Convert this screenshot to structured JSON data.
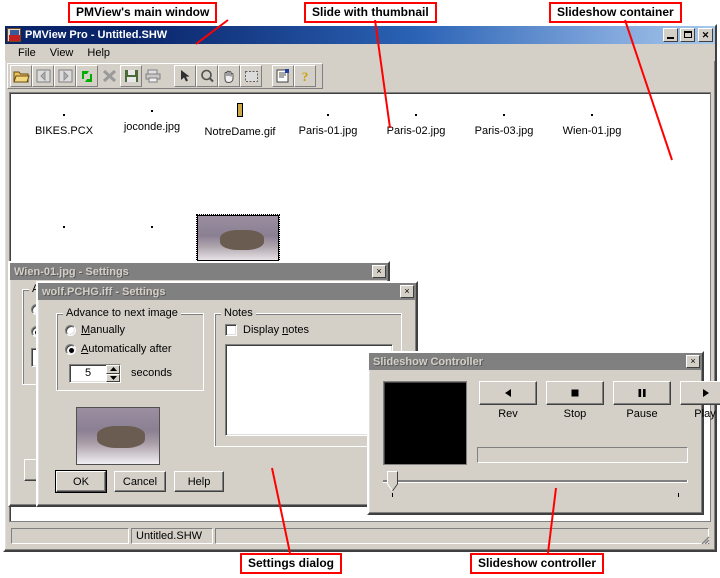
{
  "annotations": [
    {
      "id": "ann-main-window",
      "text": "PMView's main window"
    },
    {
      "id": "ann-slide-thumbnail",
      "text": "Slide with thumbnail"
    },
    {
      "id": "ann-slideshow-container",
      "text": "Slideshow container"
    },
    {
      "id": "ann-settings-dialog",
      "text": "Settings dialog"
    },
    {
      "id": "ann-slideshow-controller",
      "text": "Slideshow controller"
    }
  ],
  "main_window": {
    "title": "PMView Pro - Untitled.SHW",
    "icon": "pmview-app-icon",
    "window_buttons": {
      "minimize": "minimize-button",
      "maximize": "maximize-button",
      "close": "close-button"
    },
    "menu": [
      {
        "label": "File"
      },
      {
        "label": "View"
      },
      {
        "label": "Help"
      }
    ],
    "toolbar": [
      {
        "name": "open-folder-icon",
        "glyph": "open"
      },
      {
        "name": "previous-icon",
        "glyph": "left"
      },
      {
        "name": "next-icon",
        "glyph": "right"
      },
      {
        "name": "refresh-icon",
        "glyph": "refresh"
      },
      {
        "name": "delete-icon",
        "glyph": "x"
      },
      {
        "name": "save-icon",
        "glyph": "save"
      },
      {
        "name": "print-icon",
        "glyph": "print"
      },
      {
        "name": "pointer-icon",
        "glyph": "arrow"
      },
      {
        "name": "zoom-icon",
        "glyph": "magnifier"
      },
      {
        "name": "pan-hand-icon",
        "glyph": "hand"
      },
      {
        "name": "select-region-icon",
        "glyph": "marquee"
      },
      {
        "name": "properties-icon",
        "glyph": "properties"
      },
      {
        "name": "help-icon",
        "glyph": "question"
      }
    ],
    "slides": [
      {
        "caption": "BIKES.PCX",
        "art": "img-bikes",
        "selected": false
      },
      {
        "caption": "joconde.jpg",
        "art": "img-joconde",
        "selected": false
      },
      {
        "caption": "NotreDame.gif",
        "art": "img-notre",
        "selected": false
      },
      {
        "caption": "Paris-01.jpg",
        "art": "img-paris01",
        "selected": false
      },
      {
        "caption": "Paris-02.jpg",
        "art": "img-paris02",
        "selected": false
      },
      {
        "caption": "Paris-03.jpg",
        "art": "img-paris03",
        "selected": false
      },
      {
        "caption": "Wien-01.jpg",
        "art": "img-wien",
        "selected": false
      },
      {
        "caption": "",
        "art": "img-office",
        "selected": false
      },
      {
        "caption": "",
        "art": "img-danube",
        "selected": false
      },
      {
        "caption": "",
        "art": "img-wolf",
        "selected": true
      }
    ],
    "statusbar": {
      "left_panel": "",
      "file_panel": "Untitled.SHW",
      "right_panel": ""
    }
  },
  "settings_dialog_back": {
    "title": "Wien-01.jpg - Settings",
    "close_label": "×"
  },
  "settings_dialog_front": {
    "title": "wolf.PCHG.iff - Settings",
    "close_label": "×",
    "advance_group": {
      "label": "Advance to next image",
      "manual_option": "Manually",
      "auto_option": "Automatically after",
      "selected": "auto",
      "seconds_value": "5",
      "seconds_label": "seconds"
    },
    "notes_group": {
      "label": "Notes",
      "display_notes_label": "Display notes",
      "display_notes_checked": false,
      "notes_text": ""
    },
    "preview_art": "img-wolf-big",
    "buttons": [
      {
        "label": "OK",
        "default": true
      },
      {
        "label": "Cancel",
        "default": false
      },
      {
        "label": "Help",
        "default": false
      }
    ]
  },
  "slideshow_controller": {
    "title": "Slideshow Controller",
    "close_label": "×",
    "buttons": [
      {
        "label": "Rev",
        "icon": "rev-icon",
        "glyph": "◀"
      },
      {
        "label": "Stop",
        "icon": "stop-icon",
        "glyph": "■"
      },
      {
        "label": "Pause",
        "icon": "pause-icon",
        "glyph": "▐▌"
      },
      {
        "label": "Play",
        "icon": "play-icon",
        "glyph": "▶"
      }
    ],
    "progress_value": 0,
    "slider_value": 0
  },
  "colors": {
    "face": "#d4d0c8",
    "title_active": "#0a246a",
    "title_inactive": "#808080",
    "annotation": "#ff0000"
  }
}
